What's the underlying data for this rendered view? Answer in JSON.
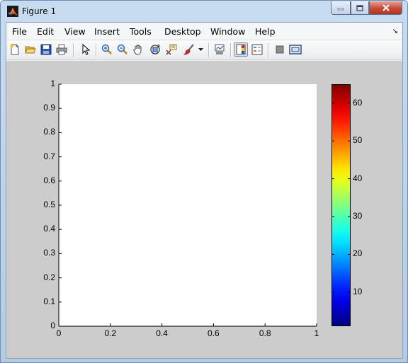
{
  "window": {
    "title": "Figure 1"
  },
  "menu": [
    "File",
    "Edit",
    "View",
    "Insert",
    "Tools",
    "Desktop",
    "Window",
    "Help"
  ],
  "menu_dock_glyph": "↘",
  "toolbar": [
    "new-figure",
    "open-file",
    "save",
    "print",
    "edit-plot-pointer",
    "zoom-in",
    "zoom-out",
    "pan",
    "rotate-3d",
    "data-cursor",
    "brush",
    "brush-dropdown",
    "link-plot",
    "insert-colorbar",
    "insert-legend",
    "hide-plot-tools",
    "show-plot-tools"
  ],
  "axes": {
    "x_ticks": [
      "0",
      "0.2",
      "0.4",
      "0.6",
      "0.8",
      "1"
    ],
    "y_ticks": [
      "0",
      "0.1",
      "0.2",
      "0.3",
      "0.4",
      "0.5",
      "0.6",
      "0.7",
      "0.8",
      "0.9",
      "1"
    ]
  },
  "colorbar": {
    "colormap": "jet",
    "range": [
      1,
      65
    ],
    "ticks": [
      "10",
      "20",
      "30",
      "40",
      "50",
      "60"
    ]
  },
  "colors": {
    "figure_bg": "#cccccc",
    "axes_bg": "#ffffff"
  }
}
